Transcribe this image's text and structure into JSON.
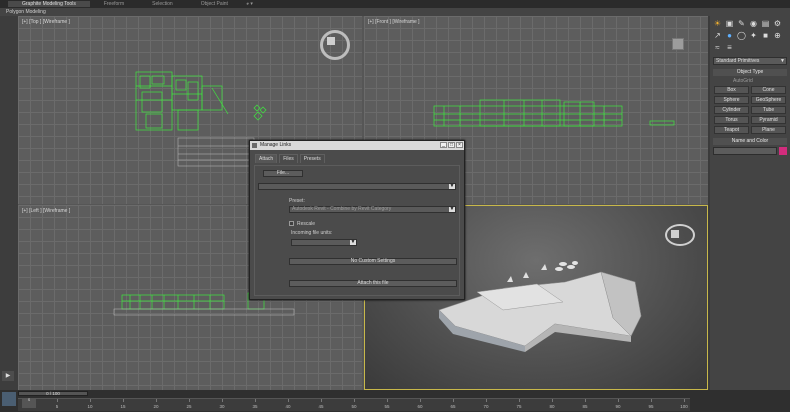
{
  "ribbon": {
    "tabs": [
      "Graphite Modeling Tools",
      "Freeform",
      "Selection",
      "Object Paint",
      "◕ ▾"
    ],
    "active_tab": 0,
    "subtab": "Polygon Modeling"
  },
  "viewports": {
    "top": "[+] [Top ] [Wireframe ]",
    "front": "[+] [Front ] [Wireframe ]",
    "left": "[+] [Left ] [Wireframe ]"
  },
  "command_panel": {
    "icons": [
      "sphere-create-icon",
      "modify-icon",
      "hierarchy-icon",
      "motion-icon",
      "display-icon",
      "utilities-icon",
      "wrench-icon"
    ],
    "category": "Standard Primitives",
    "object_type_header": "Object Type",
    "autogrid": "AutoGrid",
    "primitives": [
      "Box",
      "Cone",
      "Sphere",
      "GeoSphere",
      "Cylinder",
      "Tube",
      "Torus",
      "Pyramid",
      "Teapot",
      "Plane"
    ],
    "name_color_header": "Name and Color",
    "object_color": "#d22c7d"
  },
  "dialog": {
    "title": "Manage Links",
    "tabs": [
      "Attach",
      "Files",
      "Presets"
    ],
    "active_tab": 0,
    "file_button": "File...",
    "preset_label": "Preset:",
    "preset_value": "Autodesk Revit - Combine by Revit Category",
    "rescale_label": "Rescale",
    "incoming_units_label": "Incoming file units:",
    "no_custom_settings": "No Custom Settings",
    "attach_button": "Attach this file"
  },
  "timeline": {
    "slider": "0 / 100",
    "ticks": [
      "0",
      "5",
      "10",
      "15",
      "20",
      "25",
      "30",
      "35",
      "40",
      "45",
      "50",
      "55",
      "60",
      "65",
      "70",
      "75",
      "80",
      "85",
      "90",
      "95",
      "100"
    ],
    "setkey": "S"
  }
}
